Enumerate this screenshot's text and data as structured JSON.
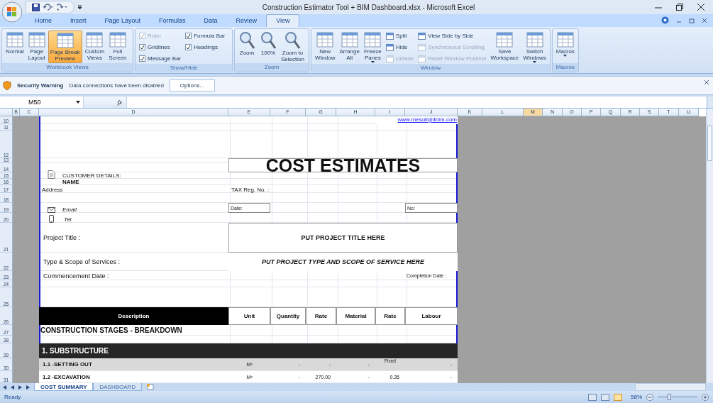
{
  "window": {
    "title": "Construction Estimator Tool + BIM Dashboard.xlsx - Microsoft Excel"
  },
  "ribbon": {
    "tabs": [
      {
        "label": "Home",
        "selected": false
      },
      {
        "label": "Insert",
        "selected": false
      },
      {
        "label": "Page Layout",
        "selected": false
      },
      {
        "label": "Formulas",
        "selected": false
      },
      {
        "label": "Data",
        "selected": false
      },
      {
        "label": "Review",
        "selected": false
      },
      {
        "label": "View",
        "selected": true
      }
    ],
    "groups": [
      {
        "label": "Workbook Views",
        "items": [
          {
            "kind": "large",
            "label": "Normal",
            "selected": false,
            "dropdown": false
          },
          {
            "kind": "large",
            "label": "Page\nLayout",
            "selected": false,
            "dropdown": false
          },
          {
            "kind": "large",
            "label": "Page Break\nPreview",
            "selected": true,
            "dropdown": false
          },
          {
            "kind": "large",
            "label": "Custom\nViews",
            "selected": false,
            "dropdown": false
          },
          {
            "kind": "large",
            "label": "Full\nScreen",
            "selected": false,
            "dropdown": false
          }
        ]
      },
      {
        "label": "Show/Hide",
        "items": [
          {
            "kind": "check",
            "label": "Ruler",
            "checked": true,
            "disabled": true
          },
          {
            "kind": "check",
            "label": "Gridlines",
            "checked": true,
            "disabled": false
          },
          {
            "kind": "check",
            "label": "Message Bar",
            "checked": true,
            "disabled": false
          },
          {
            "kind": "check",
            "label": "Formula Bar",
            "checked": true,
            "disabled": false
          },
          {
            "kind": "check",
            "label": "Headings",
            "checked": true,
            "disabled": false
          }
        ]
      },
      {
        "label": "Zoom",
        "items": [
          {
            "kind": "large",
            "label": "Zoom",
            "selected": false,
            "dropdown": false
          },
          {
            "kind": "large",
            "label": "100%",
            "selected": false,
            "dropdown": false
          },
          {
            "kind": "large",
            "label": "Zoom to\nSelection",
            "selected": false,
            "dropdown": false
          }
        ]
      },
      {
        "label": "Window",
        "items": [
          {
            "kind": "large",
            "label": "New\nWindow",
            "selected": false,
            "dropdown": false
          },
          {
            "kind": "large",
            "label": "Arrange\nAll",
            "selected": false,
            "dropdown": false
          },
          {
            "kind": "large",
            "label": "Freeze\nPanes",
            "selected": false,
            "dropdown": true
          },
          {
            "kind": "small",
            "label": "Split",
            "disabled": false
          },
          {
            "kind": "small",
            "label": "Hide",
            "disabled": false
          },
          {
            "kind": "small",
            "label": "Unhide",
            "disabled": true
          },
          {
            "kind": "small",
            "label": "View Side by Side",
            "disabled": false
          },
          {
            "kind": "small",
            "label": "Synchronous Scrolling",
            "disabled": true
          },
          {
            "kind": "small",
            "label": "Reset Window Position",
            "disabled": true
          },
          {
            "kind": "large",
            "label": "Save\nWorkspace",
            "selected": false,
            "dropdown": false
          },
          {
            "kind": "large",
            "label": "Switch\nWindows",
            "selected": false,
            "dropdown": true
          }
        ]
      },
      {
        "label": "Macros",
        "items": [
          {
            "kind": "large",
            "label": "Macros",
            "selected": false,
            "dropdown": true
          }
        ]
      }
    ]
  },
  "security_bar": {
    "title": "Security Warning",
    "message": "Data connections have been disabled",
    "button": "Options..."
  },
  "formula_bar": {
    "name_box": "M50",
    "function_label": "fx"
  },
  "column_headers": [
    {
      "label": "B",
      "selected": false
    },
    {
      "label": "C",
      "selected": false
    },
    {
      "label": "D",
      "selected": false
    },
    {
      "label": "E",
      "selected": false
    },
    {
      "label": "F",
      "selected": false
    },
    {
      "label": "G",
      "selected": false
    },
    {
      "label": "H",
      "selected": false
    },
    {
      "label": "I",
      "selected": false
    },
    {
      "label": "J",
      "selected": false
    },
    {
      "label": "K",
      "selected": false
    },
    {
      "label": "L",
      "selected": false
    },
    {
      "label": "M",
      "selected": true
    },
    {
      "label": "N",
      "selected": false
    },
    {
      "label": "O",
      "selected": false
    },
    {
      "label": "P",
      "selected": false
    },
    {
      "label": "Q",
      "selected": false
    },
    {
      "label": "R",
      "selected": false
    },
    {
      "label": "S",
      "selected": false
    },
    {
      "label": "T",
      "selected": false
    },
    {
      "label": "U",
      "selected": false
    }
  ],
  "row_headers": [
    "10",
    "11",
    "12",
    "13",
    "14",
    "15",
    "16",
    "17",
    "18",
    "19",
    "20",
    "21",
    "22",
    "23",
    "24",
    "25",
    "26",
    "27",
    "28",
    "29",
    "30",
    "31"
  ],
  "cells": [
    {
      "kind": "link",
      "text": "www.mesolightbim.com"
    },
    {
      "kind": "title",
      "text": "COST ESTIMATES"
    },
    {
      "kind": "label",
      "text": "CUSTOMER DETAILS:"
    },
    {
      "kind": "bold",
      "text": "NAME"
    },
    {
      "kind": "plain",
      "text": "Address"
    },
    {
      "kind": "plain",
      "text": "TAX Reg. No. :"
    },
    {
      "kind": "italic",
      "text": "Email"
    },
    {
      "kind": "boxed",
      "text": "Date:"
    },
    {
      "kind": "boxed",
      "text": "No:"
    },
    {
      "kind": "italic",
      "text": "Tel"
    },
    {
      "kind": "caption",
      "text": "Project Title :"
    },
    {
      "kind": "banner",
      "text": "PUT PROJECT TITLE HERE"
    },
    {
      "kind": "caption",
      "text": "Type & Scope of Services :"
    },
    {
      "kind": "banner-italic",
      "text": "PUT PROJECT TYPE AND SCOPE OF SERVICE HERE"
    },
    {
      "kind": "caption",
      "text": "Commencement Date :"
    },
    {
      "kind": "small",
      "text": "Completion Date :"
    },
    {
      "kind": "header-dark",
      "text": "Description"
    },
    {
      "kind": "header",
      "text": "Unit"
    },
    {
      "kind": "header",
      "text": "Quantity"
    },
    {
      "kind": "header",
      "text": "Rate"
    },
    {
      "kind": "header",
      "text": "Material"
    },
    {
      "kind": "header",
      "text": "Rate"
    },
    {
      "kind": "header",
      "text": "Labour"
    },
    {
      "kind": "stage",
      "text": "CONSTRUCTION STAGES - BREAKDOWN"
    },
    {
      "kind": "section",
      "text": "1. SUBSTRUCTURE"
    }
  ],
  "items": [
    {
      "shaded": true,
      "values": [
        {
          "kind": "item",
          "text": "1.1 -SETTING OUT"
        },
        {
          "kind": "unit",
          "text": "M²"
        },
        {
          "kind": "value",
          "text": "-"
        },
        {
          "kind": "value",
          "text": "-"
        },
        {
          "kind": "value",
          "text": "-"
        },
        {
          "kind": "note",
          "text": "Fixed"
        },
        {
          "kind": "value",
          "text": "-"
        }
      ]
    },
    {
      "shaded": false,
      "values": [
        {
          "kind": "item",
          "text": "1.2 -EXCAVATION"
        },
        {
          "kind": "unit",
          "text": "M³"
        },
        {
          "kind": "value",
          "text": "-"
        },
        {
          "kind": "value",
          "text": "270.00"
        },
        {
          "kind": "value",
          "text": "-"
        },
        {
          "kind": "value",
          "text": "0.35"
        },
        {
          "kind": "value",
          "text": "-"
        }
      ]
    }
  ],
  "sheet_tabs": [
    {
      "label": "COST SUMMARY",
      "selected": true
    },
    {
      "label": "DASHBOARD",
      "selected": false
    }
  ],
  "status_bar": {
    "status": "Ready",
    "zoom": "58%",
    "zoom_slider": {
      "level": 0.3
    }
  }
}
